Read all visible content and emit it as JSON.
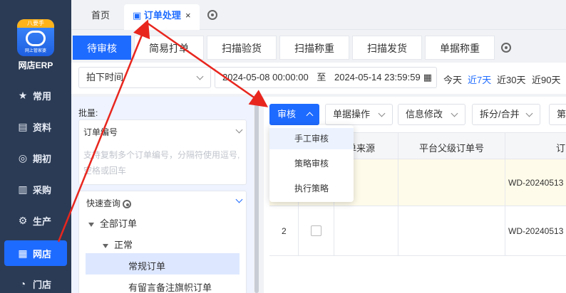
{
  "app": {
    "logo_ribbon": "八要手",
    "logo_sub": "网上管家婆",
    "name": "网店ERP"
  },
  "sidebar": {
    "items": [
      {
        "label": "常用",
        "icon": "star-icon"
      },
      {
        "label": "资料",
        "icon": "document-icon"
      },
      {
        "label": "期初",
        "icon": "target-icon"
      },
      {
        "label": "采购",
        "icon": "purchase-icon"
      },
      {
        "label": "生产",
        "icon": "production-icon"
      },
      {
        "label": "网店",
        "icon": "store-icon"
      },
      {
        "label": "门店",
        "icon": "pie-icon"
      }
    ]
  },
  "top_tabs": {
    "home": "首页",
    "active": "订单处理",
    "close": "×"
  },
  "sub_tabs": [
    "待审核",
    "简易打单",
    "扫描验货",
    "扫描称重",
    "扫描发货",
    "单据称重"
  ],
  "filter": {
    "time_type": "拍下时间",
    "start": "2024-05-08 00:00:00",
    "to": "至",
    "end": "2024-05-14 23:59:59",
    "quick": [
      "今天",
      "近7天",
      "近30天",
      "近90天"
    ]
  },
  "left": {
    "batch_label": "批量:",
    "order_no_label": "订单编号",
    "order_no_placeholder": "支持复制多个订单编号，分隔符使用逗号,空格或回车",
    "quick_query": "快速查询",
    "tree": {
      "all": "全部订单",
      "normal": "正常",
      "regular": "常规订单",
      "flagged": "有留言备注旗帜订单"
    }
  },
  "toolbar": {
    "audit": "审核",
    "doc_ops": "单据操作",
    "info_edit": "信息修改",
    "split_merge": "拆分/合并",
    "more": "第"
  },
  "dropdown": [
    "手工审核",
    "策略审核",
    "执行策略"
  ],
  "table": {
    "headers": [
      "订单来源",
      "平台父级订单号",
      "订"
    ],
    "rows": [
      {
        "index": "",
        "order": "WD-20240513"
      },
      {
        "index": "2",
        "order": "WD-20240513"
      }
    ]
  },
  "colors": {
    "sidebar_bg": "#2b3b55",
    "accent": "#1e6bff",
    "annotation_arrow": "#e8261e"
  }
}
